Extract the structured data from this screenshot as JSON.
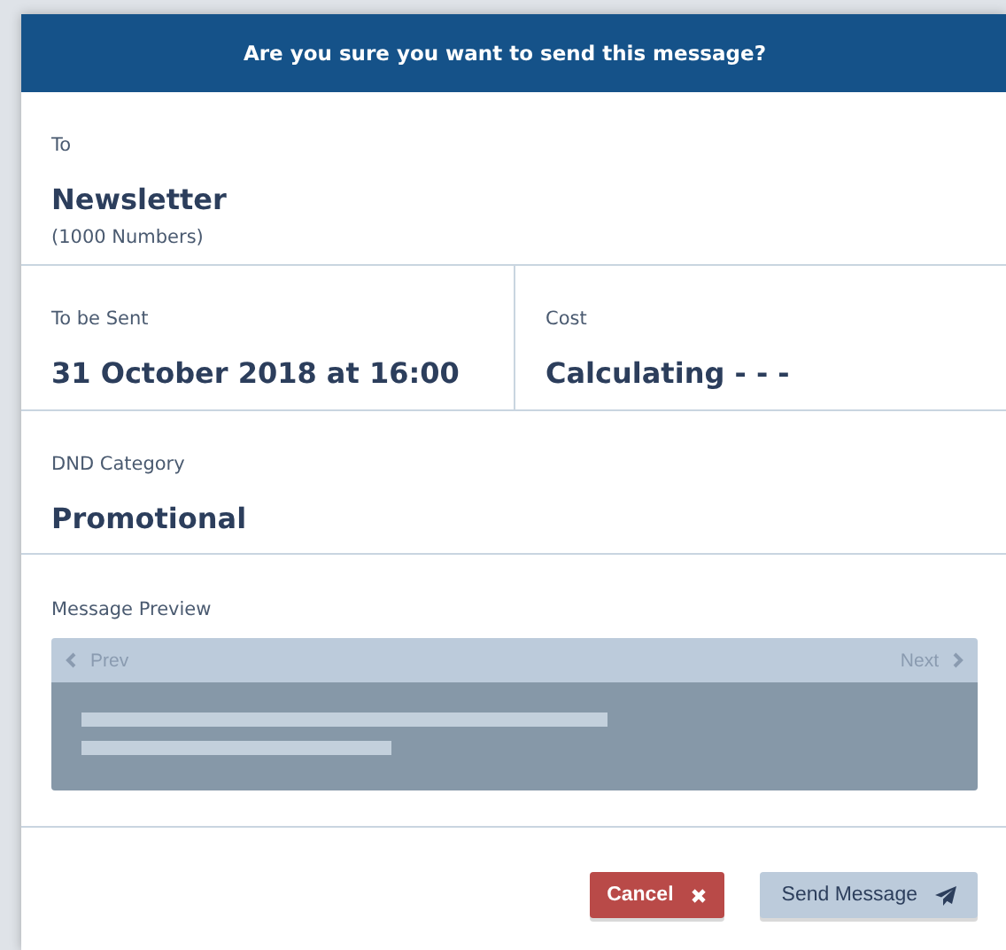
{
  "dialog": {
    "title": "Are you sure you want to send this message?"
  },
  "fields": [
    {
      "label": "To",
      "value": "Newsletter",
      "note": "(1000 Numbers)"
    },
    {
      "label": "To be Sent",
      "value": "31 October 2018 at 16:00"
    },
    {
      "label": "Cost",
      "value": "Calculating - - -"
    },
    {
      "label": "DND Category",
      "value": "Promotional"
    }
  ],
  "preview": {
    "label": "Message Preview",
    "prev": {
      "label": "Prev",
      "disabled": true
    },
    "next": {
      "label": "Next",
      "disabled": true
    }
  },
  "buttons": [
    {
      "kind": "cancel",
      "label": "Cancel"
    },
    {
      "kind": "send",
      "label": "Send Message"
    }
  ]
}
